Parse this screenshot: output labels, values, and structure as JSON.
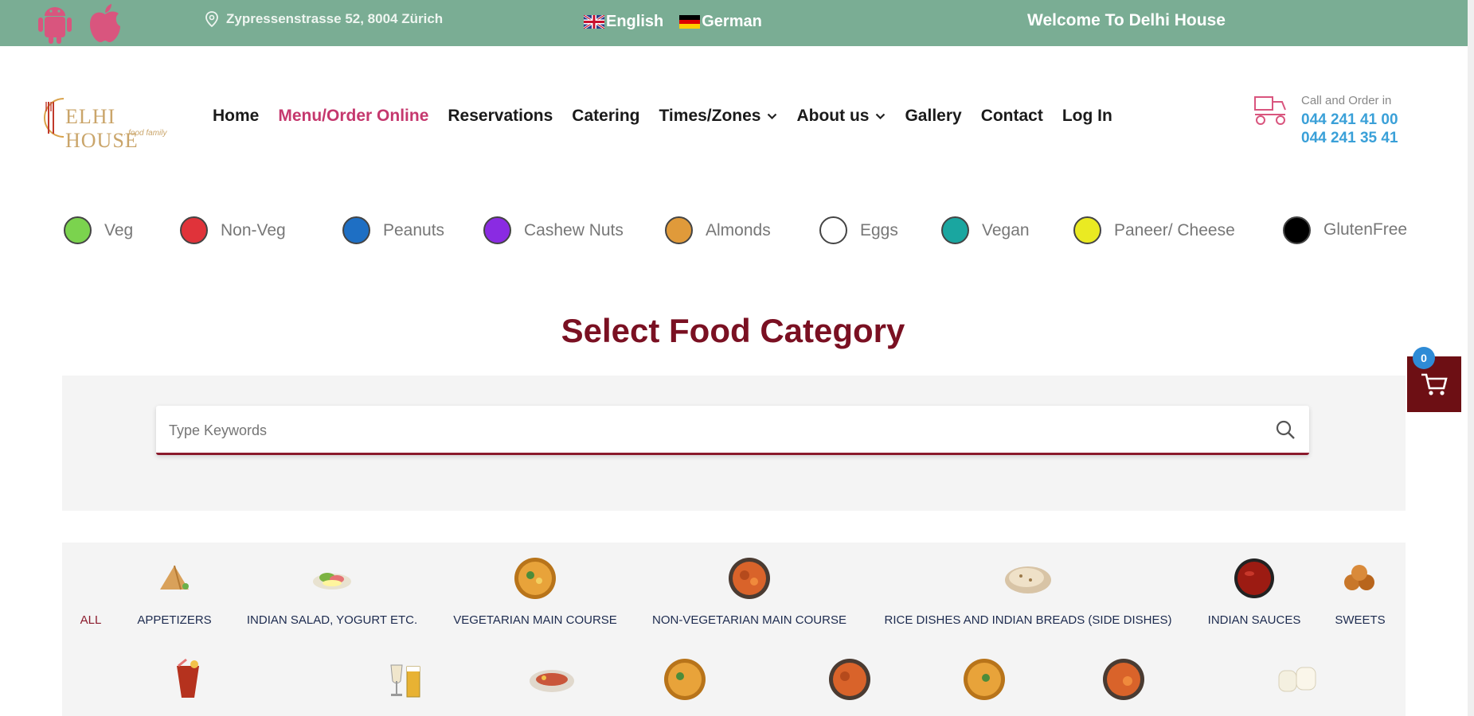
{
  "topbar": {
    "address": "Zypressenstrasse 52, 8004 Zürich",
    "languages": [
      {
        "label": "English",
        "flag": "uk-flag-icon"
      },
      {
        "label": "German",
        "flag": "germany-flag-icon"
      }
    ],
    "welcome": "Welcome To Delhi House",
    "color": "#7aad94"
  },
  "logo": {
    "text": "ELHI HOUSE",
    "sub": "... food family"
  },
  "nav": {
    "items": [
      {
        "label": "Home"
      },
      {
        "label": "Menu/Order Online",
        "active": true
      },
      {
        "label": "Reservations"
      },
      {
        "label": "Catering"
      },
      {
        "label": "Times/Zones",
        "dropdown": true
      },
      {
        "label": "About us",
        "dropdown": true
      },
      {
        "label": "Gallery"
      },
      {
        "label": "Contact"
      },
      {
        "label": "Log In"
      }
    ],
    "active_color": "#c5386e"
  },
  "call": {
    "label": "Call and Order in",
    "phone1": "044 241 41 00",
    "phone2": "044 241 35 41"
  },
  "legend": [
    {
      "label": "Veg",
      "color": "#7bd34e"
    },
    {
      "label": "Non-Veg",
      "color": "#e0333a"
    },
    {
      "label": "Peanuts",
      "color": "#1e6fc4"
    },
    {
      "label": "Cashew Nuts",
      "color": "#8a2be2"
    },
    {
      "label": "Almonds",
      "color": "#e09a3a"
    },
    {
      "label": "Eggs",
      "color": "#ffffff"
    },
    {
      "label": "Vegan",
      "color": "#1aa6a0"
    },
    {
      "label": "Paneer/ Cheese",
      "color": "#eaea22"
    },
    {
      "label": "GlutenFree",
      "color": "#000000"
    }
  ],
  "page_title": "Select Food Category",
  "search": {
    "placeholder": "Type Keywords"
  },
  "categories": [
    {
      "label": "ALL"
    },
    {
      "label": "APPETIZERS",
      "icon": "samosa-icon"
    },
    {
      "label": "INDIAN SALAD, YOGURT ETC.",
      "icon": "salad-icon"
    },
    {
      "label": "VEGETARIAN MAIN COURSE",
      "icon": "curry-bowl-icon"
    },
    {
      "label": "NON-VEGETARIAN MAIN COURSE",
      "icon": "chicken-curry-icon"
    },
    {
      "label": "RICE DISHES AND INDIAN BREADS (SIDE DISHES)",
      "icon": "naan-icon"
    },
    {
      "label": "INDIAN SAUCES",
      "icon": "sauce-bowl-icon"
    },
    {
      "label": "SWEETS",
      "icon": "sweets-icon"
    }
  ],
  "cart": {
    "count": "0"
  }
}
